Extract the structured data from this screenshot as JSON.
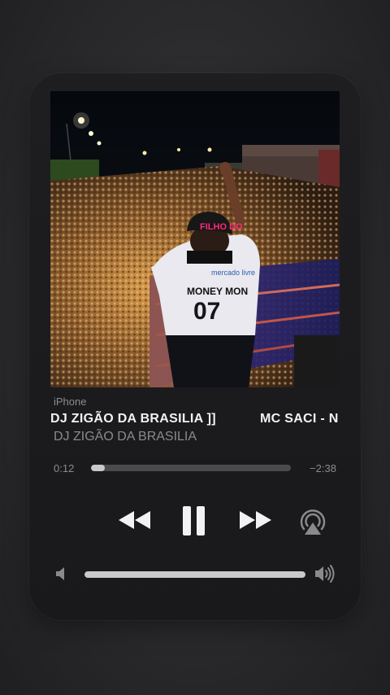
{
  "player": {
    "source": "iPhone",
    "title": "DJ ZIGÃO DA BRASILIA ]]",
    "title_next": "MC SACI - N",
    "artist": "DJ ZIGÃO DA BRASILIA",
    "elapsed": "0:12",
    "remaining": "−2:38",
    "progress": 0.07,
    "volume": 1.0
  },
  "artwork": {
    "cap_text": "FILHO DO",
    "shirt_brand": "mercado livre",
    "shirt_name": "MONEY MON",
    "shirt_number": "07"
  },
  "icons": {
    "rewind": "rewind-icon",
    "pause": "pause-icon",
    "forward": "fast-forward-icon",
    "airplay": "airplay-icon",
    "volume_low": "speaker-low-icon",
    "volume_high": "speaker-high-icon"
  },
  "colors": {
    "background": "#2c2c2e",
    "card": "#1c1c1e",
    "text_primary": "#f2f2f4",
    "text_secondary": "#8a8a8e",
    "track": "#4a4a4d",
    "fill": "#c9c9cc"
  }
}
